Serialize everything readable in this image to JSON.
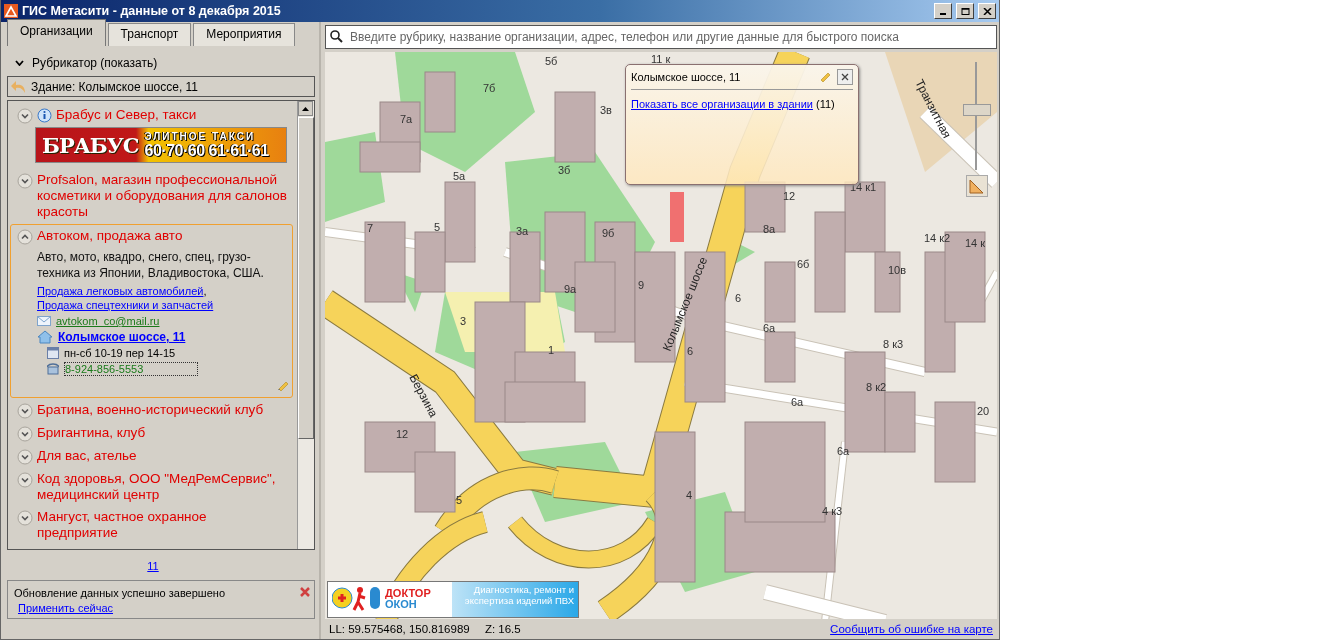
{
  "window": {
    "title": "ГИС Метасити - данные от 8 декабря 2015"
  },
  "tabs": [
    {
      "label": "Организации",
      "selected": true
    },
    {
      "label": "Транспорт",
      "selected": false
    },
    {
      "label": "Мероприятия",
      "selected": false
    }
  ],
  "rubricator": {
    "label": "Рубрикатор (показать)",
    "expanded": false
  },
  "building": {
    "label": "Здание: Колымское шоссе, 11"
  },
  "organizations": [
    {
      "name": "Брабус и Север, такси",
      "expanded": false,
      "info": true,
      "banner": {
        "brand": "БРАБУС",
        "slogan": "ЭЛИТНОЕ ТАКСИ",
        "phones": "60·70·60 61·61·61"
      }
    },
    {
      "name": "Profsalon, магазин профессиональной косметики и оборудования для салонов красоты",
      "expanded": false,
      "info": false
    },
    {
      "name": "Автоком, продажа авто",
      "expanded": true,
      "info": false,
      "description": "Авто, мото, квадро, снего, спец, грузо-техника из Японии, Владивостока, США.",
      "links": [
        "Продажа легковых автомобилей",
        "Продажа спецтехники и запчастей"
      ],
      "link_separator": ",",
      "email": "avtokom_co@mail.ru",
      "address": "Колымское шоссе, 11",
      "hours": "пн-сб 10-19 пер 14-15",
      "phone": "8-924-856-5553"
    },
    {
      "name": "Братина, военно-исторический клуб",
      "expanded": false,
      "info": false
    },
    {
      "name": "Бригантина, клуб",
      "expanded": false,
      "info": false
    },
    {
      "name": "Для вас, ателье",
      "expanded": false,
      "info": false
    },
    {
      "name": "Код здоровья, ООО \"МедРемСервис\", медицинский центр",
      "expanded": false,
      "info": false
    },
    {
      "name": "Мангуст, частное охранное предприятие",
      "expanded": false,
      "info": false
    }
  ],
  "pager": {
    "page": "11"
  },
  "notification": {
    "message": "Обновление данных успешно завершено",
    "action": "Применить сейчас"
  },
  "search": {
    "placeholder": "Введите рубрику, название организации, адрес, телефон или другие данные для быстрого поиска"
  },
  "map": {
    "streets": [
      "Колымское шоссе",
      "Берзина",
      "Транзитная"
    ],
    "labels": [
      "5б",
      "11 к",
      "7б",
      "7а",
      "3в",
      "5а",
      "3б",
      "7",
      "5",
      "3а",
      "9б",
      "9а",
      "9",
      "3",
      "1",
      "12",
      "5",
      "4",
      "6",
      "6",
      "8а",
      "6б",
      "12",
      "14 к1",
      "10в",
      "14 к2",
      "14 к",
      "6а",
      "8 к3",
      "8 к2",
      "6а",
      "6а",
      "4 к3",
      "20"
    ],
    "zoom": {
      "level": 0.55
    },
    "popup": {
      "title": "Колымское шоссе, 11",
      "link": "Показать все организации в здании",
      "count": "(11)"
    },
    "ad": {
      "brand_line1": "ДОКТОР",
      "brand_line2": "ОКОН",
      "text": "Диагностика, ремонт и экспертиза изделий ПВХ"
    }
  },
  "status_bar": {
    "coordinates": "LL: 59.575468, 150.816989",
    "zoom": "Z: 16.5",
    "report_link": "Сообщить об ошибке на карте"
  }
}
